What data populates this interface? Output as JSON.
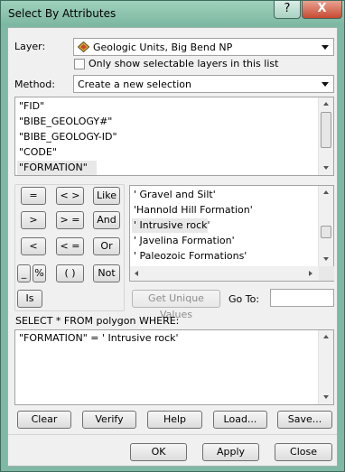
{
  "window": {
    "title": "Select By Attributes",
    "help_glyph": "?",
    "close_glyph": "X"
  },
  "layer": {
    "label": "Layer:",
    "value": "Geologic Units, Big Bend NP",
    "icon": "layer-symbol-icon"
  },
  "only_selectable": {
    "label": "Only show selectable layers in this list",
    "checked": false
  },
  "method": {
    "label": "Method:",
    "value": "Create a new selection"
  },
  "fields": [
    "\"FID\"",
    "\"BIBE_GEOLOGY#\"",
    "\"BIBE_GEOLOGY-ID\"",
    "\"CODE\"",
    "\"FORMATION\""
  ],
  "selected_field": "\"FORMATION\"",
  "operators": {
    "eq": "=",
    "ne": "< >",
    "like": "Like",
    "gt": ">",
    "ge": "> =",
    "and": "And",
    "lt": "<",
    "le": "< =",
    "or": "Or",
    "underscore": "_",
    "percent": "%",
    "parens": "( )",
    "not": "Not",
    "is": "Is"
  },
  "values": [
    "' Gravel and Silt'",
    "'Hannold Hill Formation'",
    "' Intrusive rock'",
    "' Javelina Formation'",
    "' Paleozoic Formations'"
  ],
  "selected_value": "' Intrusive rock'",
  "get_unique": "Get Unique Values",
  "goto": {
    "label": "Go To:",
    "value": ""
  },
  "sql_label": "SELECT * FROM polygon WHERE:",
  "expression": "\"FORMATION\" = ' Intrusive rock'",
  "buttons": {
    "clear": "Clear",
    "verify": "Verify",
    "help": "Help",
    "load": "Load...",
    "save": "Save...",
    "ok": "OK",
    "apply": "Apply",
    "close": "Close"
  },
  "colors": {
    "frame": "#7fb8a4",
    "close_button": "#c74a32",
    "selection": "#e8e8e8"
  }
}
